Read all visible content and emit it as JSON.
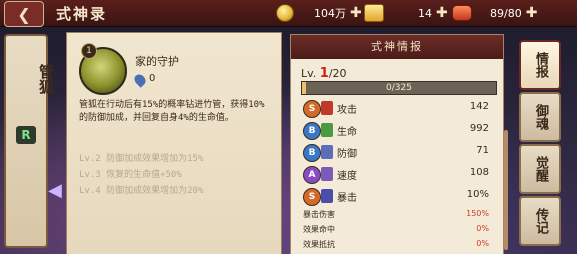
{
  "header": {
    "back_icon": "chevron-left-icon",
    "title": "式神录",
    "resources": [
      {
        "icon": "gold-coin-icon",
        "value": "104万"
      },
      {
        "icon": "jade-icon",
        "value": "14"
      },
      {
        "icon": "stamina-scroll-icon",
        "value": "89/80"
      }
    ]
  },
  "shikigami": {
    "name": "管狐",
    "rarity": "R"
  },
  "skill": {
    "badge": "1",
    "name": "家的守护",
    "cost": "0",
    "description": "管狐在行动后有15%的概率钻进竹管，获得10%的防御加成，并回复自身4%的生命值。",
    "levels": [
      "Lv.2  防御加成效果增加为15%",
      "Lv.3  恢复的生命值+50%",
      "Lv.4  防御加成效果增加为20%"
    ]
  },
  "info": {
    "header": "式神情报",
    "level_prefix": "Lv. ",
    "level": "1",
    "level_max": "/20",
    "exp_text": "0/325",
    "exp_fraction": 0.02,
    "stats": [
      {
        "grade": "S",
        "grade_color": "#d46a2a",
        "icon_color": "#c0392b",
        "label": "攻击",
        "value": "142"
      },
      {
        "grade": "B",
        "grade_color": "#3a77c6",
        "icon_color": "#4a9a42",
        "label": "生命",
        "value": "992"
      },
      {
        "grade": "B",
        "grade_color": "#3a77c6",
        "icon_color": "#5b6fb8",
        "label": "防御",
        "value": "71"
      },
      {
        "grade": "A",
        "grade_color": "#8a4bc2",
        "icon_color": "#7a5bb8",
        "label": "速度",
        "value": "108"
      },
      {
        "grade": "S",
        "grade_color": "#d46a2a",
        "icon_color": "#4a4ea8",
        "label": "暴击",
        "value": "10%"
      }
    ],
    "extra": [
      {
        "label": "暴击伤害",
        "value": "150%"
      },
      {
        "label": "效果命中",
        "value": "0%"
      },
      {
        "label": "效果抵抗",
        "value": "0%"
      }
    ]
  },
  "tabs": [
    {
      "label": "情报"
    },
    {
      "label": "御魂"
    },
    {
      "label": "觉醒"
    },
    {
      "label": "传记"
    }
  ]
}
